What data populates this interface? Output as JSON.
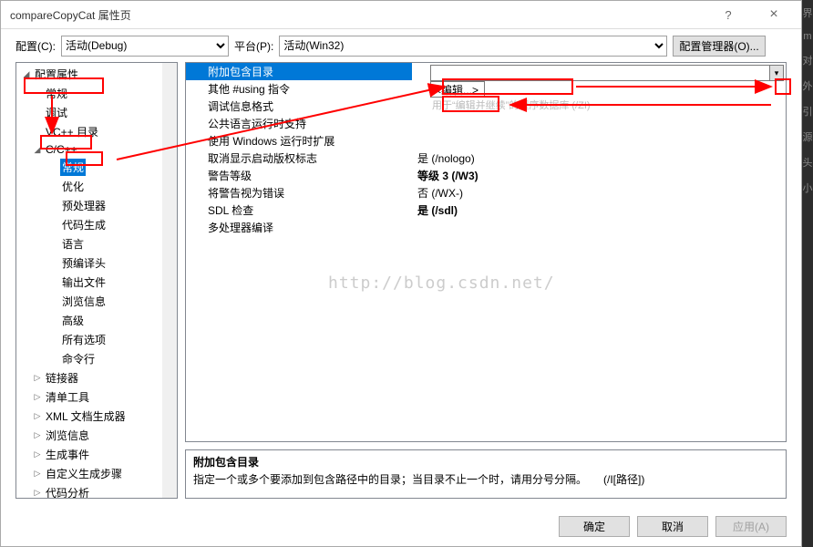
{
  "titlebar": {
    "title": "compareCopyCat 属性页",
    "help": "?",
    "close": "×"
  },
  "config": {
    "label_config": "配置(C):",
    "config_selected": "活动(Debug)",
    "label_platform": "平台(P):",
    "platform_selected": "活动(Win32)",
    "config_mgr_label": "配置管理器(O)..."
  },
  "tree": {
    "root": "配置属性",
    "general": "常规",
    "debug": "调试",
    "vcdirs": "VC++ 目录",
    "ccpp": "C/C++",
    "ccpp_general": "常规",
    "ccpp_optimize": "优化",
    "ccpp_preproc": "预处理器",
    "ccpp_codegen": "代码生成",
    "ccpp_lang": "语言",
    "ccpp_pch": "预编译头",
    "ccpp_output": "输出文件",
    "ccpp_browse": "浏览信息",
    "ccpp_advanced": "高级",
    "ccpp_allopts": "所有选项",
    "ccpp_cmdline": "命令行",
    "linker": "链接器",
    "manifest": "清单工具",
    "xmldoc": "XML 文档生成器",
    "browseinfo": "浏览信息",
    "buildevents": "生成事件",
    "custombuild": "自定义生成步骤",
    "codeanalysis": "代码分析"
  },
  "props": {
    "additional_include": {
      "label": "附加包含目录",
      "value": ""
    },
    "edit_popup": "<编辑...>",
    "using_dirs": {
      "label": "其他 #using 指令",
      "value": ""
    },
    "debug_format": {
      "label": "调试信息格式",
      "ghost": "用于“编辑并继续”的程序数据库 (/ZI)"
    },
    "clr_support": {
      "label": "公共语言运行时支持",
      "value": ""
    },
    "winrt_ext": {
      "label": "使用 Windows 运行时扩展",
      "value": ""
    },
    "nologo": {
      "label": "取消显示启动版权标志",
      "value": "是 (/nologo)"
    },
    "warn_level": {
      "label": "警告等级",
      "value": "等级 3 (/W3)"
    },
    "warn_as_error": {
      "label": "将警告视为错误",
      "value": "否 (/WX-)"
    },
    "sdl": {
      "label": "SDL 检查",
      "value": "是 (/sdl)"
    },
    "multiproc": {
      "label": "多处理器编译",
      "value": ""
    }
  },
  "description": {
    "title": "附加包含目录",
    "text": "指定一个或多个要添加到包含路径中的目录；当目录不止一个时，请用分号分隔。　　(/I[路径])"
  },
  "buttons": {
    "ok": "确定",
    "cancel": "取消",
    "apply": "应用(A)"
  },
  "watermark": "http://blog.csdn.net/",
  "side": [
    "界",
    "m",
    "对",
    "外",
    "引",
    "源",
    "头",
    "小"
  ]
}
